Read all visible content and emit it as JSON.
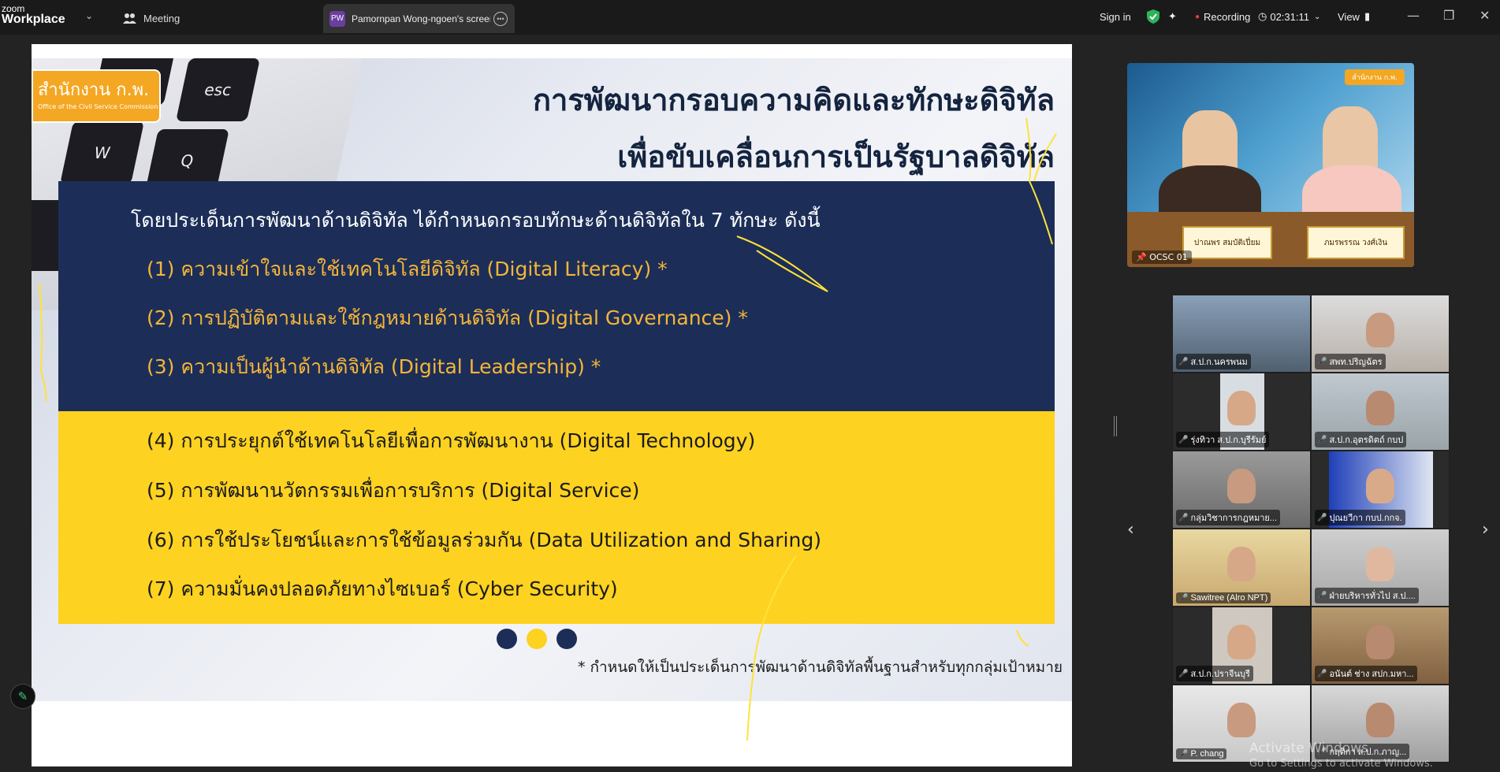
{
  "app": {
    "logo_top": "zoom",
    "logo_bottom": "Workplace",
    "meeting_tab": "Meeting",
    "share_avatar": "PW",
    "share_tab": "Pamornpan Wong-ngoen's screen",
    "sign_in": "Sign in",
    "recording": "Recording",
    "timer": "02:31:11",
    "view": "View"
  },
  "slide": {
    "logo_text": "สำนักงาน ก.พ.",
    "logo_sub": "Office of the Civil Service Commission",
    "title_line1": "การพัฒนากรอบความคิดและทักษะดิจิทัล",
    "title_line2": "เพื่อขับเคลื่อนการเป็นรัฐบาลดิจิทัล",
    "intro": "โดยประเด็นการพัฒนาด้านดิจิทัล ได้กำหนดกรอบทักษะด้านดิจิทัลใน 7 ทักษะ ดังนี้",
    "items": [
      "(1) ความเข้าใจและใช้เทคโนโลยีดิจิทัล (Digital Literacy) *",
      "(2) การปฏิบัติตามและใช้กฎหมายด้านดิจิทัล (Digital Governance) *",
      "(3) ความเป็นผู้นำด้านดิจิทัล (Digital Leadership) *",
      "(4) การประยุกต์ใช้เทคโนโลยีเพื่อการพัฒนางาน (Digital Technology)",
      "(5) การพัฒนานวัตกรรมเพื่อการบริการ (Digital Service)",
      "(6) การใช้ประโยชน์และการใช้ข้อมูลร่วมกัน (Data Utilization and Sharing)",
      "(7) ความมั่นคงปลอดภัยทางไซเบอร์ (Cyber Security)"
    ],
    "footnote": "* กำหนดให้เป็นประเด็นการพัฒนาด้านดิจิทัลพื้นฐานสำหรับทุกกลุ่มเป้าหมาย",
    "colors": {
      "navy": "#1c2e58",
      "yellow": "#fdd220",
      "orange_text": "#f5b538"
    }
  },
  "main_video": {
    "label": "OCSC 01",
    "nameplate_left": "ปาณพร สมบัติเปี่ยม",
    "nameplate_right": "ภมรพรรณ วงศ์เงิน",
    "logo": "สำนักงาน ก.พ."
  },
  "participants": [
    {
      "name": "ส.ป.ก.นครพนม"
    },
    {
      "name": "สพท.ปริญฉัตร"
    },
    {
      "name": "รุ่งทิวา ส.ป.ก.บุรีรัมย์"
    },
    {
      "name": "ส.ป.ก.อุตรดิตถ์ กบป"
    },
    {
      "name": "กลุ่มวิชาการกฎหมาย..."
    },
    {
      "name": "ปุณยวีกา กบป.กกจ."
    },
    {
      "name": "Sawitree (Alro NPT)"
    },
    {
      "name": "ฝ่ายบริหารทั่วไป ส.ป...."
    },
    {
      "name": "ส.ป.ก.ปราจีนบุรี"
    },
    {
      "name": "อนันต์ ช่าง สปก.มหา..."
    },
    {
      "name": "P. chang"
    },
    {
      "name": "กฤติกา ส.ป.ก.ภาญ..."
    }
  ],
  "watermark": {
    "line1": "Activate Windows",
    "line2": "Go to Settings to activate Windows."
  }
}
